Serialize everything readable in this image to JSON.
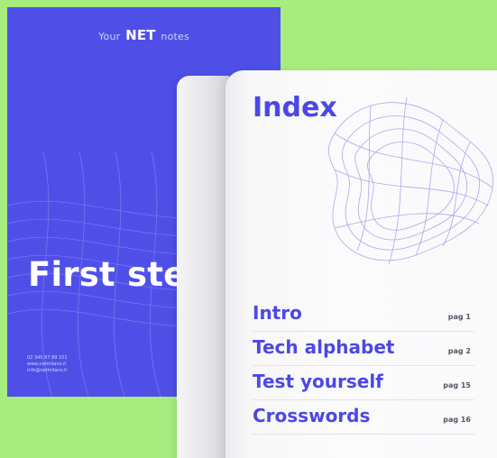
{
  "cover": {
    "brand_prefix": "Your",
    "brand_name": "NET",
    "brand_suffix": "notes",
    "title": "First ste",
    "contact_lines": [
      "02 345 67 89 101",
      "www.netmilano.it",
      "info@netmilano.it"
    ]
  },
  "index": {
    "title": "Index",
    "items": [
      {
        "label": "Intro",
        "page": "pag 1"
      },
      {
        "label": "Tech alphabet",
        "page": "pag 2"
      },
      {
        "label": "Test yourself",
        "page": "pag 15"
      },
      {
        "label": "Crosswords",
        "page": "pag 16"
      }
    ]
  },
  "colors": {
    "background": "#a6ec7f",
    "cover_blue": "#4f4fe8",
    "accent_text": "#4b48e6",
    "mesh_line": "#8f8ce6"
  }
}
